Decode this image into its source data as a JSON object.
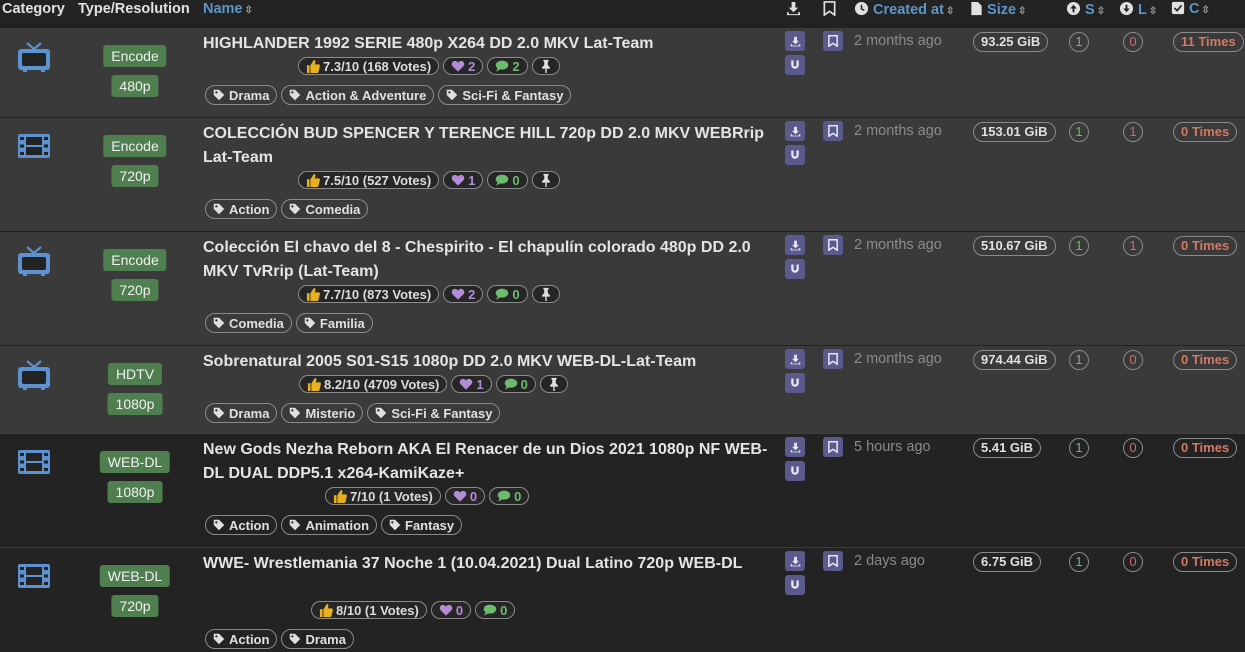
{
  "header": {
    "category": "Category",
    "type_resolution": "Type/Resolution",
    "name": "Name",
    "created_at": "Created at",
    "size": "Size",
    "seeders": "S",
    "leechers": "L",
    "completed": "C"
  },
  "rows": [
    {
      "category_icon": "tv-icon",
      "type": "Encode",
      "resolution": "480p",
      "name": "HIGHLANDER 1992 SERIE 480p X264 DD 2.0 MKV Lat-Team",
      "rating": "7.3/10 (168 Votes)",
      "likes": "2",
      "comments": "2",
      "pinned": true,
      "genres": [
        "Drama",
        "Action & Adventure",
        "Sci-Fi & Fantasy"
      ],
      "created": "2 months ago",
      "size": "93.25 GiB",
      "seeders": "1",
      "leechers": "0",
      "completed": "11 Times"
    },
    {
      "category_icon": "film-icon",
      "type": "Encode",
      "resolution": "720p",
      "name": "COLECCIÓN BUD SPENCER Y TERENCE HILL 720p DD 2.0 MKV WEBRrip Lat-Team",
      "rating": "7.5/10 (527 Votes)",
      "likes": "1",
      "comments": "0",
      "pinned": true,
      "genres": [
        "Action",
        "Comedia"
      ],
      "created": "2 months ago",
      "size": "153.01 GiB",
      "seeders": "1",
      "leechers": "1",
      "completed": "0 Times"
    },
    {
      "category_icon": "tv-icon",
      "type": "Encode",
      "resolution": "720p",
      "name": "Colección El chavo del 8 - Chespirito - El chapulín colorado 480p DD 2.0 MKV TvRrip (Lat-Team)",
      "rating": "7.7/10 (873 Votes)",
      "likes": "2",
      "comments": "0",
      "pinned": true,
      "genres": [
        "Comedia",
        "Familia"
      ],
      "created": "2 months ago",
      "size": "510.67 GiB",
      "seeders": "1",
      "leechers": "1",
      "completed": "0 Times"
    },
    {
      "category_icon": "tv-icon",
      "type": "HDTV",
      "resolution": "1080p",
      "name": "Sobrenatural 2005 S01-S15 1080p DD 2.0 MKV WEB-DL-Lat-Team",
      "rating": "8.2/10 (4709 Votes)",
      "likes": "1",
      "comments": "0",
      "pinned": true,
      "genres": [
        "Drama",
        "Misterio",
        "Sci-Fi & Fantasy"
      ],
      "created": "2 months ago",
      "size": "974.44 GiB",
      "seeders": "1",
      "leechers": "0",
      "completed": "0 Times"
    },
    {
      "category_icon": "film-icon",
      "type": "WEB-DL",
      "resolution": "1080p",
      "name": "New Gods Nezha Reborn AKA El Renacer de un Dios 2021 1080p NF WEB-DL DUAL DDP5.1 x264-KamiKaze+",
      "rating": "7/10 (1 Votes)",
      "likes": "0",
      "comments": "0",
      "pinned": false,
      "genres": [
        "Action",
        "Animation",
        "Fantasy"
      ],
      "created": "5 hours ago",
      "size": "5.41 GiB",
      "seeders": "1",
      "leechers": "0",
      "completed": "0 Times"
    },
    {
      "category_icon": "film-icon",
      "type": "WEB-DL",
      "resolution": "720p",
      "name": "WWE- Wrestlemania 37 Noche 1 (10.04.2021) Dual Latino 720p WEB-DL",
      "rating": "8/10 (1 Votes)",
      "likes": "0",
      "comments": "0",
      "pinned": false,
      "genres": [
        "Action",
        "Drama"
      ],
      "created": "2 days ago",
      "size": "6.75 GiB",
      "seeders": "1",
      "leechers": "0",
      "completed": "0 Times"
    }
  ]
}
